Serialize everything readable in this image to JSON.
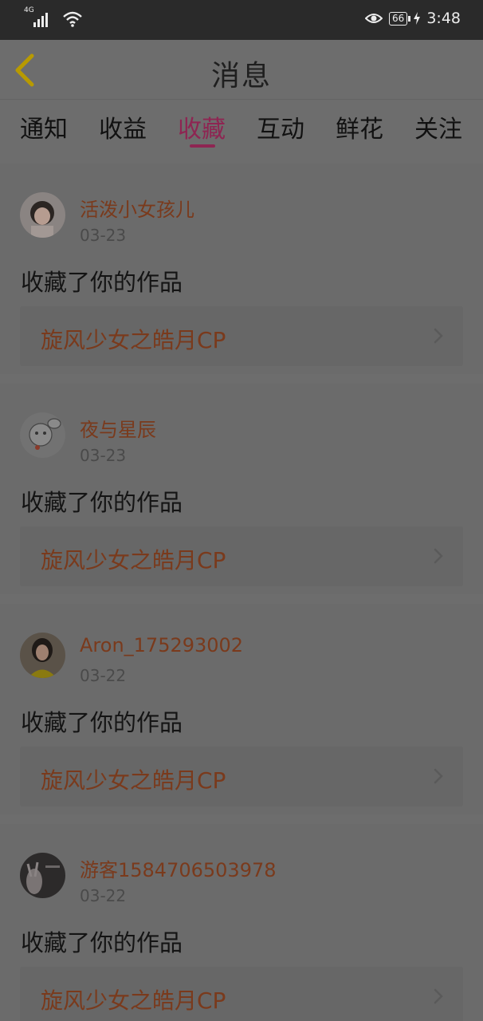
{
  "status_bar": {
    "network": "4G",
    "battery": "66",
    "time": "3:48"
  },
  "header": {
    "title": "消息"
  },
  "tabs": [
    {
      "label": "通知"
    },
    {
      "label": "收益"
    },
    {
      "label": "收藏"
    },
    {
      "label": "互动"
    },
    {
      "label": "鲜花"
    },
    {
      "label": "关注"
    }
  ],
  "active_tab": "收藏",
  "colors": {
    "accent": "#8e2552",
    "name_text": "#7a3a1c",
    "status_bar": "#2a2a2a"
  },
  "messages": [
    {
      "username": "活泼小女孩儿",
      "date": "03-23",
      "action": "收藏了你的作品",
      "work_title": "旋风少女之皓月CP"
    },
    {
      "username": "夜与星辰",
      "date": "03-23",
      "action": "收藏了你的作品",
      "work_title": "旋风少女之皓月CP"
    },
    {
      "username": "Aron_175293002",
      "date": "03-22",
      "action": "收藏了你的作品",
      "work_title": "旋风少女之皓月CP"
    },
    {
      "username": "游客1584706503978",
      "date": "03-22",
      "action": "收藏了你的作品",
      "work_title": "旋风少女之皓月CP"
    }
  ]
}
